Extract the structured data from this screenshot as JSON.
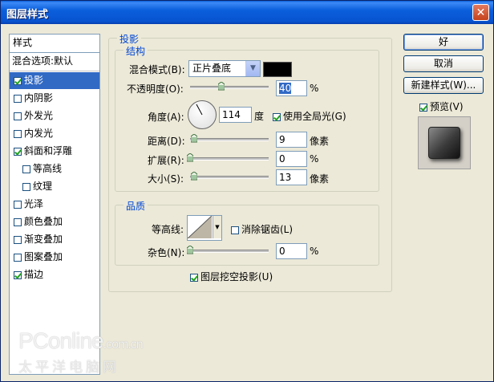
{
  "window": {
    "title": "图层样式",
    "close_glyph": "✕"
  },
  "stylelist": {
    "header": "样式",
    "blend_options": "混合选项:默认",
    "items": [
      {
        "label": "投影",
        "checked": true,
        "selected": true,
        "indent": false
      },
      {
        "label": "内阴影",
        "checked": false,
        "selected": false,
        "indent": false
      },
      {
        "label": "外发光",
        "checked": false,
        "selected": false,
        "indent": false
      },
      {
        "label": "内发光",
        "checked": false,
        "selected": false,
        "indent": false
      },
      {
        "label": "斜面和浮雕",
        "checked": true,
        "selected": false,
        "indent": false
      },
      {
        "label": "等高线",
        "checked": false,
        "selected": false,
        "indent": true
      },
      {
        "label": "纹理",
        "checked": false,
        "selected": false,
        "indent": true
      },
      {
        "label": "光泽",
        "checked": false,
        "selected": false,
        "indent": false
      },
      {
        "label": "颜色叠加",
        "checked": false,
        "selected": false,
        "indent": false
      },
      {
        "label": "渐变叠加",
        "checked": false,
        "selected": false,
        "indent": false
      },
      {
        "label": "图案叠加",
        "checked": false,
        "selected": false,
        "indent": false
      },
      {
        "label": "描边",
        "checked": true,
        "selected": false,
        "indent": false
      }
    ]
  },
  "shadow": {
    "title": "投影",
    "structure": {
      "title": "结构",
      "blend_mode_label": "混合模式(B):",
      "blend_mode_value": "正片叠底",
      "color": "#000000",
      "opacity_label": "不透明度(O):",
      "opacity_value": "40",
      "opacity_unit": "%",
      "opacity_level": 0.4,
      "angle_label": "角度(A):",
      "angle_value": "114",
      "angle_unit": "度",
      "global_light_label": "使用全局光(G)",
      "global_light_checked": true,
      "distance_label": "距离(D):",
      "distance_value": "9",
      "distance_unit": "像素",
      "distance_level": 0.05,
      "spread_label": "扩展(R):",
      "spread_value": "0",
      "spread_unit": "%",
      "spread_level": 0.0,
      "size_label": "大小(S):",
      "size_value": "13",
      "size_unit": "像素",
      "size_level": 0.05
    },
    "quality": {
      "title": "品质",
      "contour_label": "等高线:",
      "antialias_label": "消除锯齿(L)",
      "antialias_checked": false,
      "noise_label": "杂色(N):",
      "noise_value": "0",
      "noise_unit": "%",
      "noise_level": 0.0
    },
    "knockout_label": "图层挖空投影(U)",
    "knockout_checked": true
  },
  "buttons": {
    "ok": "好",
    "cancel": "取消",
    "new_style": "新建样式(W)...",
    "preview_label": "预览(V)",
    "preview_checked": true
  },
  "watermark": {
    "line1": "PConline",
    "line1_suffix": ".com.cn",
    "line2": "太平洋电脑网"
  }
}
